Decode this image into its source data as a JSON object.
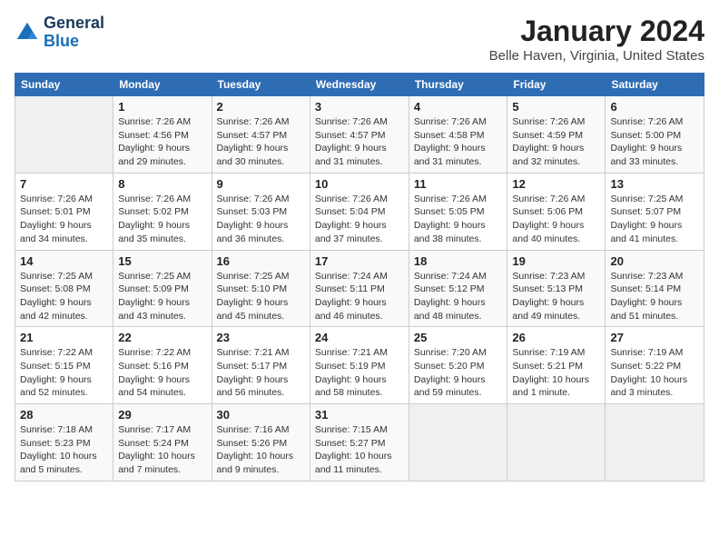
{
  "header": {
    "logo_line1": "General",
    "logo_line2": "Blue",
    "main_title": "January 2024",
    "subtitle": "Belle Haven, Virginia, United States"
  },
  "days_of_week": [
    "Sunday",
    "Monday",
    "Tuesday",
    "Wednesday",
    "Thursday",
    "Friday",
    "Saturday"
  ],
  "weeks": [
    [
      {
        "day": "",
        "info": ""
      },
      {
        "day": "1",
        "info": "Sunrise: 7:26 AM\nSunset: 4:56 PM\nDaylight: 9 hours\nand 29 minutes."
      },
      {
        "day": "2",
        "info": "Sunrise: 7:26 AM\nSunset: 4:57 PM\nDaylight: 9 hours\nand 30 minutes."
      },
      {
        "day": "3",
        "info": "Sunrise: 7:26 AM\nSunset: 4:57 PM\nDaylight: 9 hours\nand 31 minutes."
      },
      {
        "day": "4",
        "info": "Sunrise: 7:26 AM\nSunset: 4:58 PM\nDaylight: 9 hours\nand 31 minutes."
      },
      {
        "day": "5",
        "info": "Sunrise: 7:26 AM\nSunset: 4:59 PM\nDaylight: 9 hours\nand 32 minutes."
      },
      {
        "day": "6",
        "info": "Sunrise: 7:26 AM\nSunset: 5:00 PM\nDaylight: 9 hours\nand 33 minutes."
      }
    ],
    [
      {
        "day": "7",
        "info": "Sunrise: 7:26 AM\nSunset: 5:01 PM\nDaylight: 9 hours\nand 34 minutes."
      },
      {
        "day": "8",
        "info": "Sunrise: 7:26 AM\nSunset: 5:02 PM\nDaylight: 9 hours\nand 35 minutes."
      },
      {
        "day": "9",
        "info": "Sunrise: 7:26 AM\nSunset: 5:03 PM\nDaylight: 9 hours\nand 36 minutes."
      },
      {
        "day": "10",
        "info": "Sunrise: 7:26 AM\nSunset: 5:04 PM\nDaylight: 9 hours\nand 37 minutes."
      },
      {
        "day": "11",
        "info": "Sunrise: 7:26 AM\nSunset: 5:05 PM\nDaylight: 9 hours\nand 38 minutes."
      },
      {
        "day": "12",
        "info": "Sunrise: 7:26 AM\nSunset: 5:06 PM\nDaylight: 9 hours\nand 40 minutes."
      },
      {
        "day": "13",
        "info": "Sunrise: 7:25 AM\nSunset: 5:07 PM\nDaylight: 9 hours\nand 41 minutes."
      }
    ],
    [
      {
        "day": "14",
        "info": "Sunrise: 7:25 AM\nSunset: 5:08 PM\nDaylight: 9 hours\nand 42 minutes."
      },
      {
        "day": "15",
        "info": "Sunrise: 7:25 AM\nSunset: 5:09 PM\nDaylight: 9 hours\nand 43 minutes."
      },
      {
        "day": "16",
        "info": "Sunrise: 7:25 AM\nSunset: 5:10 PM\nDaylight: 9 hours\nand 45 minutes."
      },
      {
        "day": "17",
        "info": "Sunrise: 7:24 AM\nSunset: 5:11 PM\nDaylight: 9 hours\nand 46 minutes."
      },
      {
        "day": "18",
        "info": "Sunrise: 7:24 AM\nSunset: 5:12 PM\nDaylight: 9 hours\nand 48 minutes."
      },
      {
        "day": "19",
        "info": "Sunrise: 7:23 AM\nSunset: 5:13 PM\nDaylight: 9 hours\nand 49 minutes."
      },
      {
        "day": "20",
        "info": "Sunrise: 7:23 AM\nSunset: 5:14 PM\nDaylight: 9 hours\nand 51 minutes."
      }
    ],
    [
      {
        "day": "21",
        "info": "Sunrise: 7:22 AM\nSunset: 5:15 PM\nDaylight: 9 hours\nand 52 minutes."
      },
      {
        "day": "22",
        "info": "Sunrise: 7:22 AM\nSunset: 5:16 PM\nDaylight: 9 hours\nand 54 minutes."
      },
      {
        "day": "23",
        "info": "Sunrise: 7:21 AM\nSunset: 5:17 PM\nDaylight: 9 hours\nand 56 minutes."
      },
      {
        "day": "24",
        "info": "Sunrise: 7:21 AM\nSunset: 5:19 PM\nDaylight: 9 hours\nand 58 minutes."
      },
      {
        "day": "25",
        "info": "Sunrise: 7:20 AM\nSunset: 5:20 PM\nDaylight: 9 hours\nand 59 minutes."
      },
      {
        "day": "26",
        "info": "Sunrise: 7:19 AM\nSunset: 5:21 PM\nDaylight: 10 hours\nand 1 minute."
      },
      {
        "day": "27",
        "info": "Sunrise: 7:19 AM\nSunset: 5:22 PM\nDaylight: 10 hours\nand 3 minutes."
      }
    ],
    [
      {
        "day": "28",
        "info": "Sunrise: 7:18 AM\nSunset: 5:23 PM\nDaylight: 10 hours\nand 5 minutes."
      },
      {
        "day": "29",
        "info": "Sunrise: 7:17 AM\nSunset: 5:24 PM\nDaylight: 10 hours\nand 7 minutes."
      },
      {
        "day": "30",
        "info": "Sunrise: 7:16 AM\nSunset: 5:26 PM\nDaylight: 10 hours\nand 9 minutes."
      },
      {
        "day": "31",
        "info": "Sunrise: 7:15 AM\nSunset: 5:27 PM\nDaylight: 10 hours\nand 11 minutes."
      },
      {
        "day": "",
        "info": ""
      },
      {
        "day": "",
        "info": ""
      },
      {
        "day": "",
        "info": ""
      }
    ]
  ]
}
